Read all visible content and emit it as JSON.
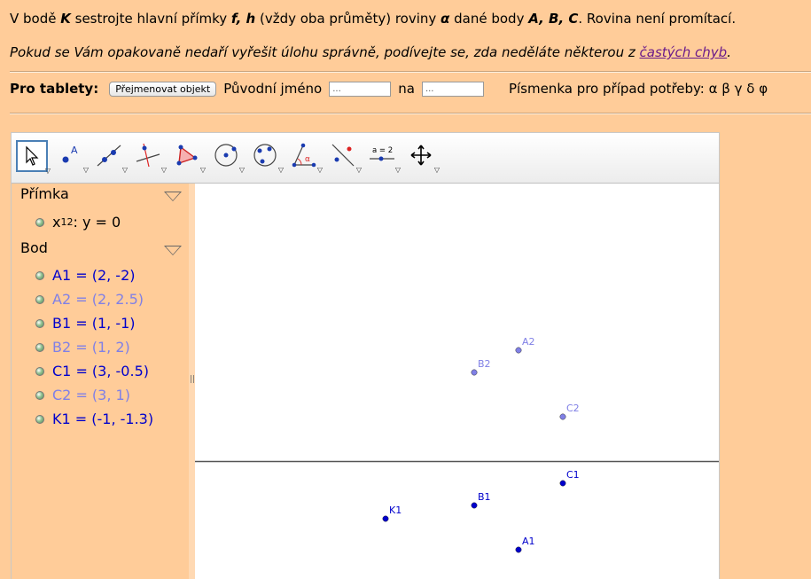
{
  "task": {
    "p1": "V bodě ",
    "K": "K",
    "p2": " sestrojte hlavní přímky ",
    "fh": "f, h",
    "p3": " (vždy oba průměty) roviny ",
    "alpha": "α",
    "p4": " dané body ",
    "ABC": "A, B, C",
    "p5": ". Rovina není promítací."
  },
  "note": {
    "text": "Pokud se Vám opakovaně nedaří vyřešit úlohu správně, podívejte se, zda neděláte některou z ",
    "link": "častých chyb",
    "end": "."
  },
  "tablet": {
    "label": "Pro tablety:",
    "rename_button": "Přejmenovat objekt",
    "orig_label": "Původní jméno",
    "orig_value": "...",
    "to_label": "na",
    "to_value": "...",
    "letters_label": "Písmenka pro případ potřeby: α β γ δ φ"
  },
  "toolbar": {
    "tools": [
      "move-tool",
      "point-tool",
      "line-tool",
      "perpendicular-line-tool",
      "polygon-tool",
      "circle-center-point-tool",
      "circle-three-points-tool",
      "angle-tool",
      "reflect-tool",
      "slider-tool",
      "move-graphics-view-tool"
    ],
    "slider_text": "a = 2"
  },
  "algebra": {
    "categories": [
      {
        "title": "Přímka",
        "items": [
          {
            "text": "x",
            "sub": "12",
            "rest": ": y = 0",
            "style": "black"
          }
        ]
      },
      {
        "title": "Bod",
        "items": [
          {
            "text": "A1 = (2, -2)",
            "style": "dark"
          },
          {
            "text": "A2 = (2, 2.5)",
            "style": "light"
          },
          {
            "text": "B1 = (1, -1)",
            "style": "dark"
          },
          {
            "text": "B2 = (1, 2)",
            "style": "light"
          },
          {
            "text": "C1 = (3, -0.5)",
            "style": "dark"
          },
          {
            "text": "C2 = (3, 1)",
            "style": "light"
          },
          {
            "text": "K1 = (-1, -1.3)",
            "style": "dark"
          }
        ]
      }
    ]
  },
  "graphics": {
    "axis_line": "x12",
    "points": [
      {
        "name": "A2",
        "x": 2,
        "y": 2.5,
        "color": "#8080e6"
      },
      {
        "name": "B2",
        "x": 1,
        "y": 2,
        "color": "#8080e6"
      },
      {
        "name": "C2",
        "x": 3,
        "y": 1,
        "color": "#8080e6"
      },
      {
        "name": "C1",
        "x": 3,
        "y": -0.5,
        "color": "#0000cc"
      },
      {
        "name": "B1",
        "x": 1,
        "y": -1,
        "color": "#0000cc"
      },
      {
        "name": "K1",
        "x": -1,
        "y": -1.3,
        "color": "#0000cc"
      },
      {
        "name": "A1",
        "x": 2,
        "y": -2,
        "color": "#0000cc"
      }
    ]
  }
}
